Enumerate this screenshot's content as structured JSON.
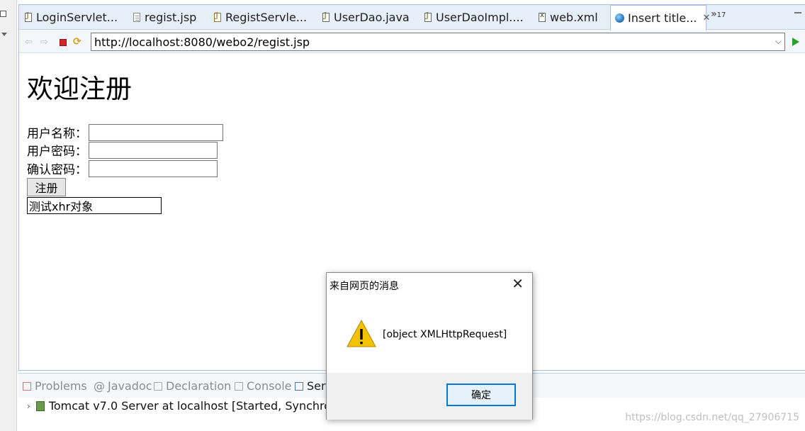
{
  "tabs": [
    {
      "label": "LoginServlet...",
      "icon": "java-file-icon"
    },
    {
      "label": "regist.jsp",
      "icon": "jsp-file-icon"
    },
    {
      "label": "RegistServle...",
      "icon": "servlet-file-icon"
    },
    {
      "label": "UserDao.java",
      "icon": "java-file-icon"
    },
    {
      "label": "UserDaoImpl....",
      "icon": "java-file-icon"
    },
    {
      "label": "web.xml",
      "icon": "xml-file-icon"
    },
    {
      "label": "Insert title...",
      "icon": "globe-icon",
      "active": true
    }
  ],
  "tab_overflow": {
    "symbol": "»",
    "count": "17"
  },
  "browser": {
    "url": "http://localhost:8080/webo2/regist.jsp"
  },
  "page": {
    "title": "欢迎注册",
    "username_label": "用户名称：",
    "password_label": "用户密码：",
    "confirm_label": "确认密码：",
    "submit_label": "注册",
    "test_value": "测试xhr对象"
  },
  "bottom_panel": {
    "tabs": [
      {
        "label": "Problems",
        "icon": "problems-icon"
      },
      {
        "label": "Javadoc",
        "icon": "at-icon"
      },
      {
        "label": "Declaration",
        "icon": "declaration-icon"
      },
      {
        "label": "Console",
        "icon": "console-icon"
      },
      {
        "label": "Ser",
        "icon": "servers-icon",
        "active": true
      }
    ],
    "server_row": "Tomcat v7.0 Server at localhost  [Started, Synchronize"
  },
  "watermark": "https://blog.csdn.net/qq_27906715",
  "dialog": {
    "title": "来自网页的消息",
    "message": "[object XMLHttpRequest]",
    "ok_label": "确定"
  },
  "colors": {
    "tab_bar": "#e6eef7",
    "warning_yellow": "#f2c200",
    "ok_border": "#0078d7"
  }
}
